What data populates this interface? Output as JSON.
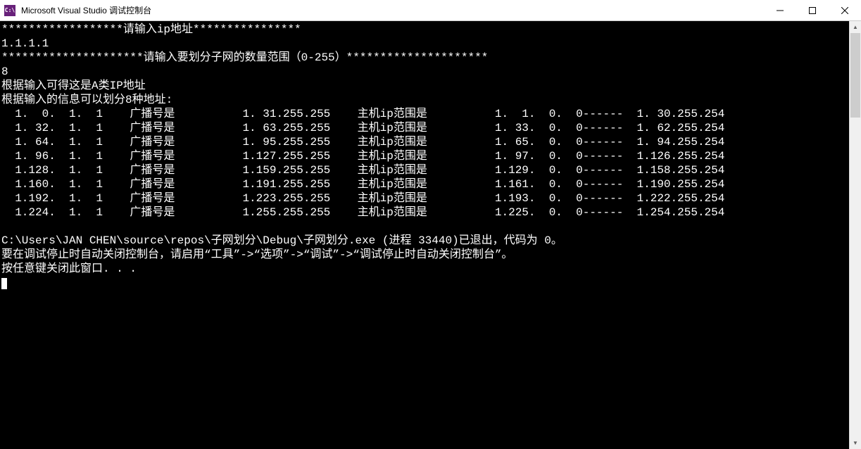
{
  "window": {
    "icon_text": "C:\\",
    "title": "Microsoft Visual Studio 调试控制台"
  },
  "console": {
    "prompt1": "******************请输入ip地址****************",
    "input_ip": "1.1.1.1",
    "prompt2": "*********************请输入要划分子网的数量范围（0-255）*********************",
    "input_count": "8",
    "result_class": "根据输入可得这是A类IP地址",
    "result_intro": "根据输入的信息可以划分8种地址:",
    "label_broadcast": "广播号是",
    "label_hostrange": "主机ip范围是",
    "dash": "------",
    "rows": [
      {
        "net": "  1.  0.  1.  1",
        "bcast": "  1. 31.255.255",
        "from": "  1.  1.  0.  0",
        "to": "  1. 30.255.254"
      },
      {
        "net": "  1. 32.  1.  1",
        "bcast": "  1. 63.255.255",
        "from": "  1. 33.  0.  0",
        "to": "  1. 62.255.254"
      },
      {
        "net": "  1. 64.  1.  1",
        "bcast": "  1. 95.255.255",
        "from": "  1. 65.  0.  0",
        "to": "  1. 94.255.254"
      },
      {
        "net": "  1. 96.  1.  1",
        "bcast": "  1.127.255.255",
        "from": "  1. 97.  0.  0",
        "to": "  1.126.255.254"
      },
      {
        "net": "  1.128.  1.  1",
        "bcast": "  1.159.255.255",
        "from": "  1.129.  0.  0",
        "to": "  1.158.255.254"
      },
      {
        "net": "  1.160.  1.  1",
        "bcast": "  1.191.255.255",
        "from": "  1.161.  0.  0",
        "to": "  1.190.255.254"
      },
      {
        "net": "  1.192.  1.  1",
        "bcast": "  1.223.255.255",
        "from": "  1.193.  0.  0",
        "to": "  1.222.255.254"
      },
      {
        "net": "  1.224.  1.  1",
        "bcast": "  1.255.255.255",
        "from": "  1.225.  0.  0",
        "to": "  1.254.255.254"
      }
    ],
    "blank": "",
    "exit_line": "C:\\Users\\JAN CHEN\\source\\repos\\子网划分\\Debug\\子网划分.exe (进程 33440)已退出，代码为 0。",
    "hint_line": "要在调试停止时自动关闭控制台，请启用“工具”->“选项”->“调试”->“调试停止时自动关闭控制台”。",
    "press_key": "按任意键关闭此窗口. . ."
  }
}
